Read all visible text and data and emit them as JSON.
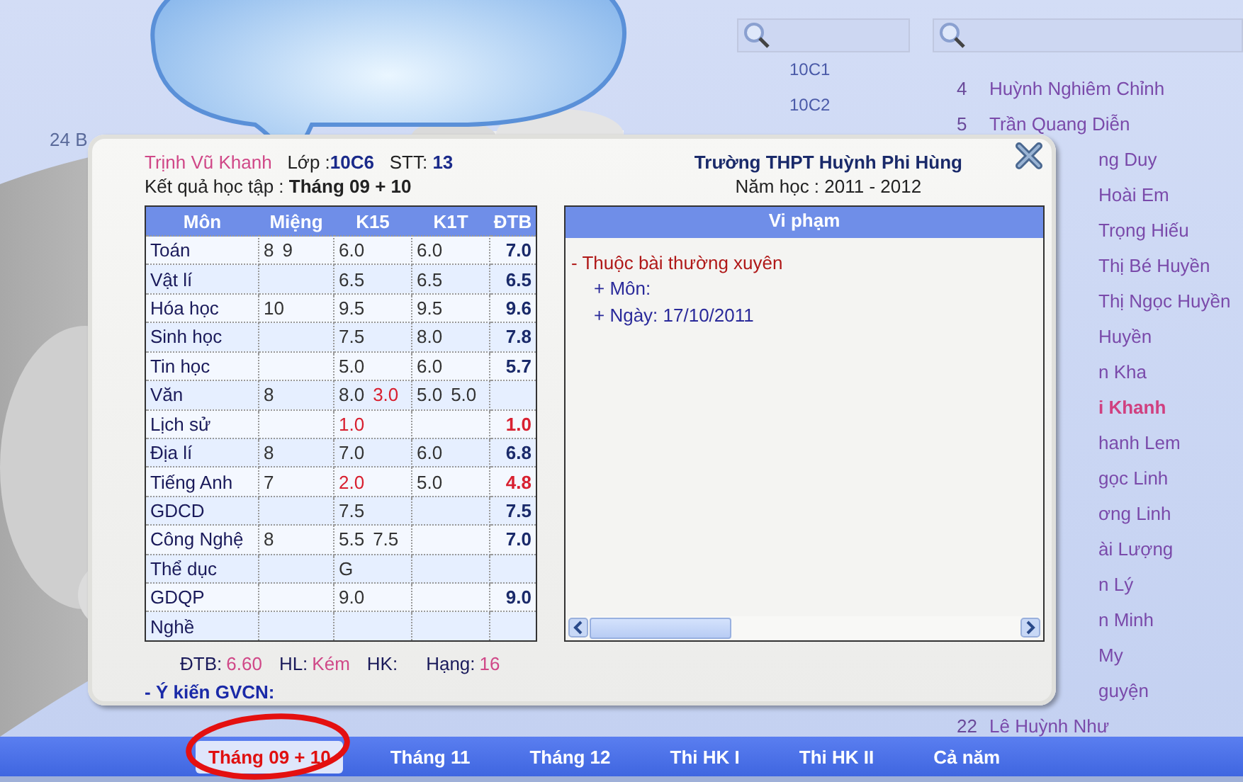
{
  "background": {
    "left_list": [
      "24 B"
    ],
    "classes": [
      "10C1",
      "10C2"
    ],
    "students": [
      {
        "number": "4",
        "name": "Huỳnh Nghiêm Chỉnh",
        "selected": false
      },
      {
        "number": "5",
        "name": "Trần Quang Diễn",
        "selected": false
      },
      {
        "name": "ng Duy",
        "selected": false
      },
      {
        "name": "Hoài Em",
        "selected": false
      },
      {
        "name": "Trọng Hiếu",
        "selected": false
      },
      {
        "name": "Thị Bé Huyền",
        "selected": false
      },
      {
        "name": "Thị Ngọc Huyền",
        "selected": false
      },
      {
        "name": "Huyền",
        "selected": false
      },
      {
        "name": "n Kha",
        "selected": false
      },
      {
        "name": "i Khanh",
        "selected": true
      },
      {
        "name": "hanh Lem",
        "selected": false
      },
      {
        "name": "gọc Linh",
        "selected": false
      },
      {
        "name": "ơng Linh",
        "selected": false
      },
      {
        "name": "ài Lượng",
        "selected": false
      },
      {
        "name": "n Lý",
        "selected": false
      },
      {
        "name": "n Minh",
        "selected": false
      },
      {
        "name": "My",
        "selected": false
      },
      {
        "name": "guyện",
        "selected": false
      },
      {
        "number": "22",
        "name": "Lê Huỳnh Như",
        "selected": false
      }
    ]
  },
  "dialog": {
    "student": "Trịnh Vũ Khanh",
    "class_label": "Lớp :",
    "class": "10C6",
    "stt_label": "STT:",
    "stt": "13",
    "period_label": "Kết quả học tập :",
    "period": "Tháng 09 + 10",
    "school": "Trường THPT Huỳnh Phi Hùng",
    "year": "Năm học : 2011 - 2012",
    "table": {
      "columns": [
        "Môn",
        "Miệng",
        "K15",
        "K1T",
        "ĐTB"
      ],
      "rows": [
        {
          "subject": "Toán",
          "mieng": [
            {
              "value": "8",
              "failing": false
            },
            {
              "value": "9",
              "failing": false
            }
          ],
          "k15": [
            {
              "value": "6.0",
              "failing": false
            }
          ],
          "k1t": [
            {
              "value": "6.0",
              "failing": false
            }
          ],
          "dtb": {
            "value": "7.0",
            "failing": false
          }
        },
        {
          "subject": "Vật lí",
          "mieng": [],
          "k15": [
            {
              "value": "6.5",
              "failing": false
            }
          ],
          "k1t": [
            {
              "value": "6.5",
              "failing": false
            }
          ],
          "dtb": {
            "value": "6.5",
            "failing": false
          }
        },
        {
          "subject": "Hóa học",
          "mieng": [
            {
              "value": "10",
              "failing": false
            }
          ],
          "k15": [
            {
              "value": "9.5",
              "failing": false
            }
          ],
          "k1t": [
            {
              "value": "9.5",
              "failing": false
            }
          ],
          "dtb": {
            "value": "9.6",
            "failing": false
          }
        },
        {
          "subject": "Sinh học",
          "mieng": [],
          "k15": [
            {
              "value": "7.5",
              "failing": false
            }
          ],
          "k1t": [
            {
              "value": "8.0",
              "failing": false
            }
          ],
          "dtb": {
            "value": "7.8",
            "failing": false
          }
        },
        {
          "subject": "Tin học",
          "mieng": [],
          "k15": [
            {
              "value": "5.0",
              "failing": false
            }
          ],
          "k1t": [
            {
              "value": "6.0",
              "failing": false
            }
          ],
          "dtb": {
            "value": "5.7",
            "failing": false
          }
        },
        {
          "subject": "Văn",
          "mieng": [
            {
              "value": "8",
              "failing": false
            }
          ],
          "k15": [
            {
              "value": "8.0",
              "failing": false
            },
            {
              "value": "3.0",
              "failing": true
            }
          ],
          "k1t": [
            {
              "value": "5.0",
              "failing": false
            },
            {
              "value": "5.0",
              "failing": false
            }
          ]
        },
        {
          "subject": "Lịch sử",
          "mieng": [],
          "k15": [
            {
              "value": "1.0",
              "failing": true
            }
          ],
          "k1t": [],
          "dtb": {
            "value": "1.0",
            "failing": true
          }
        },
        {
          "subject": "Địa lí",
          "mieng": [
            {
              "value": "8",
              "failing": false
            }
          ],
          "k15": [
            {
              "value": "7.0",
              "failing": false
            }
          ],
          "k1t": [
            {
              "value": "6.0",
              "failing": false
            }
          ],
          "dtb": {
            "value": "6.8",
            "failing": false
          }
        },
        {
          "subject": "Tiếng Anh",
          "mieng": [
            {
              "value": "7",
              "failing": false
            }
          ],
          "k15": [
            {
              "value": "2.0",
              "failing": true
            }
          ],
          "k1t": [
            {
              "value": "5.0",
              "failing": false
            }
          ],
          "dtb": {
            "value": "4.8",
            "failing": true
          }
        },
        {
          "subject": "GDCD",
          "mieng": [],
          "k15": [
            {
              "value": "7.5",
              "failing": false
            }
          ],
          "k1t": [],
          "dtb": {
            "value": "7.5",
            "failing": false
          }
        },
        {
          "subject": "Công Nghệ",
          "mieng": [
            {
              "value": "8",
              "failing": false
            }
          ],
          "k15": [
            {
              "value": "5.5",
              "failing": false
            },
            {
              "value": "7.5",
              "failing": false
            }
          ],
          "k1t": [],
          "dtb": {
            "value": "7.0",
            "failing": false
          }
        },
        {
          "subject": "Thể dục",
          "mieng": [],
          "k15": [
            {
              "value": "G",
              "failing": false
            }
          ],
          "k1t": []
        },
        {
          "subject": "GDQP",
          "mieng": [],
          "k15": [
            {
              "value": "9.0",
              "failing": false
            }
          ],
          "k1t": [],
          "dtb": {
            "value": "9.0",
            "failing": false
          }
        },
        {
          "subject": "Nghề",
          "mieng": [],
          "k15": [],
          "k1t": []
        }
      ]
    },
    "violations": {
      "title": "Vi phạm",
      "items": [
        {
          "title": "- Thuộc bài thường xuyên",
          "details": [
            "+ Môn:",
            "+ Ngày: 17/10/2011"
          ]
        }
      ]
    },
    "summary": [
      {
        "label": "ĐTB:",
        "value": "6.60"
      },
      {
        "label": "HL:",
        "value": "Kém"
      },
      {
        "label": "HK:"
      },
      {
        "label": "Hạng:",
        "value": "16"
      }
    ],
    "comment_label": "- Ý kiến GVCN:"
  },
  "tabs": [
    {
      "label": "Tháng 09 + 10",
      "selected": true
    },
    {
      "label": "Tháng 11",
      "selected": false
    },
    {
      "label": "Tháng 12",
      "selected": false
    },
    {
      "label": "Thi HK I",
      "selected": false
    },
    {
      "label": "Thi HK II",
      "selected": false
    },
    {
      "label": "Cả năm",
      "selected": false
    }
  ]
}
